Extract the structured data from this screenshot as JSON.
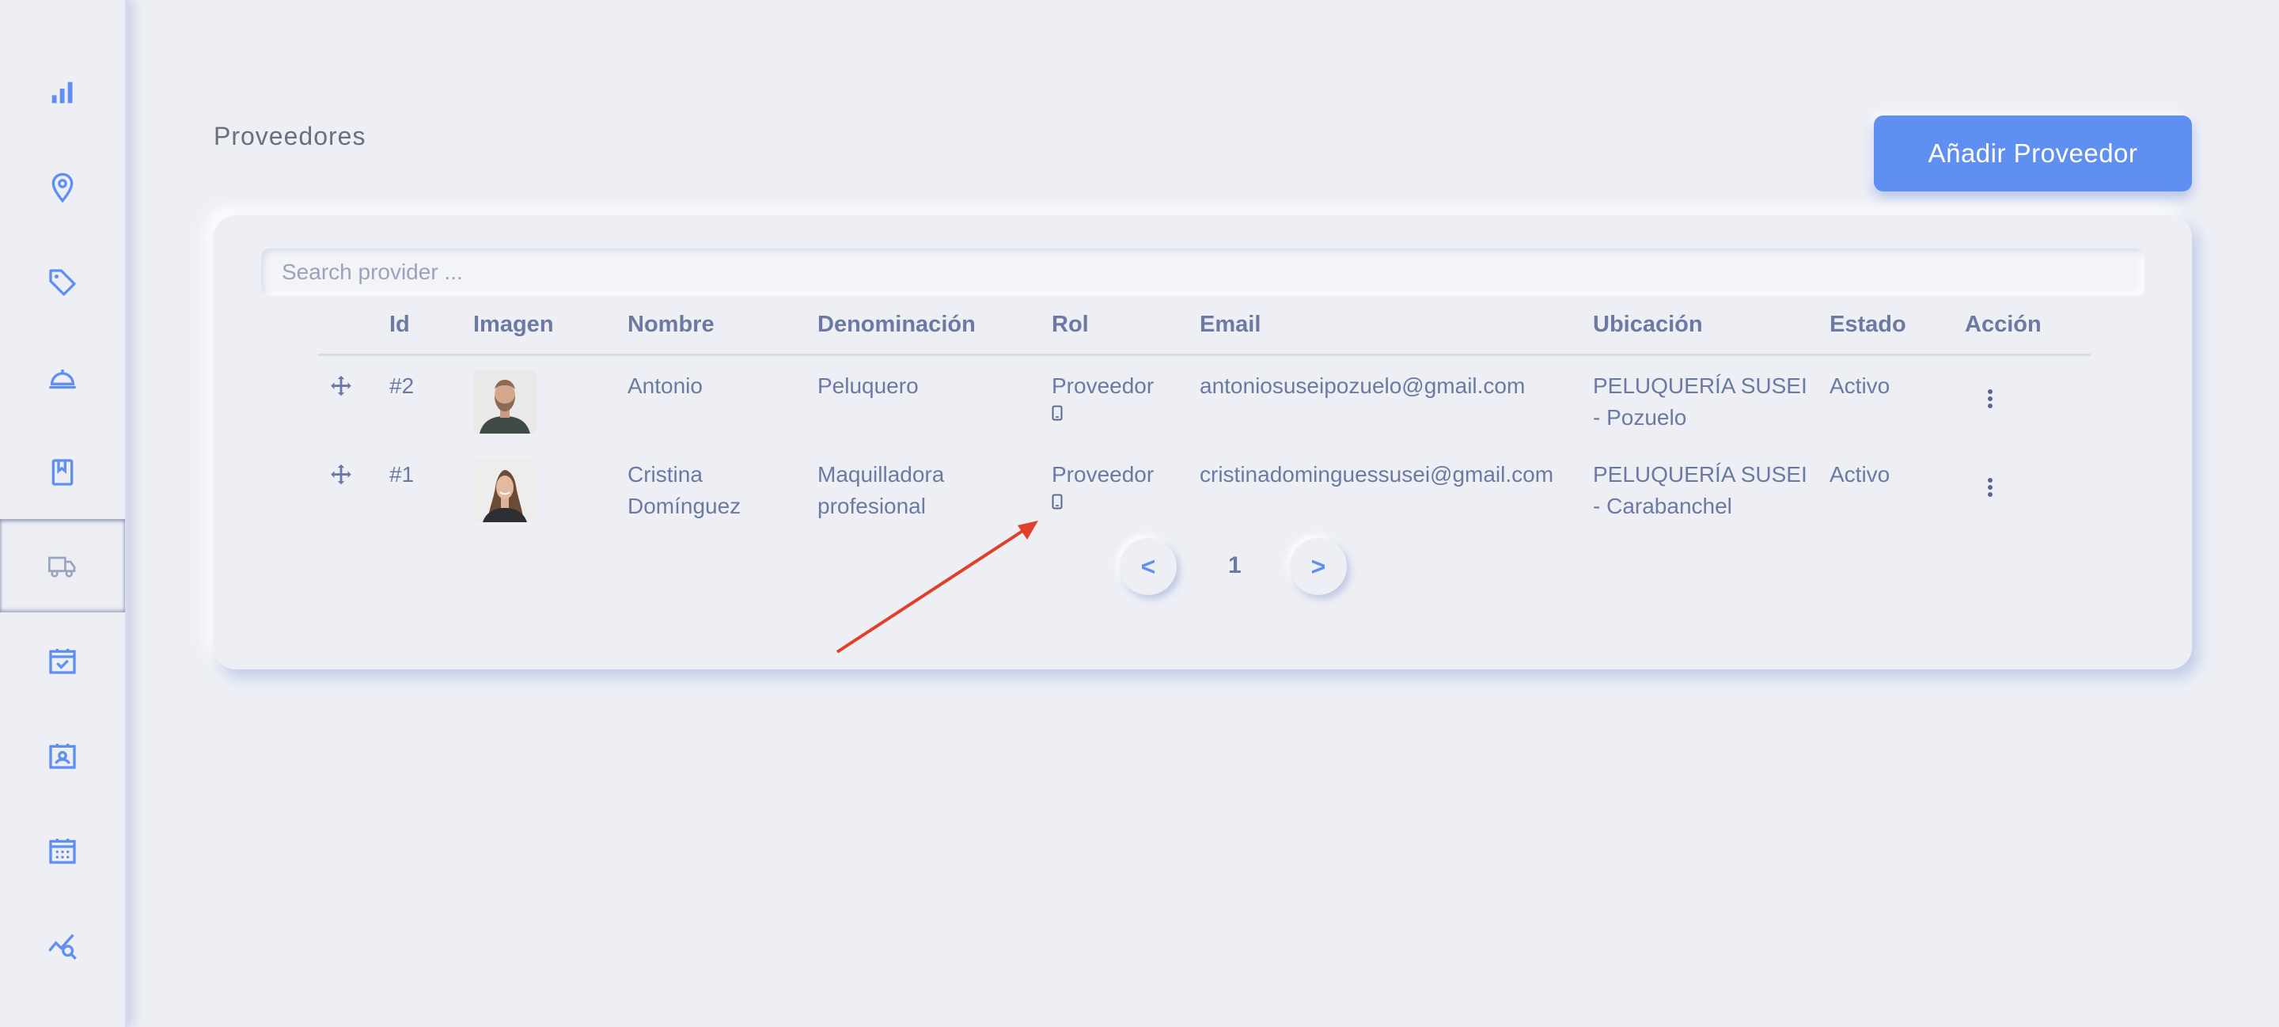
{
  "sidebar": {
    "items": [
      {
        "icon": "bar-chart-icon"
      },
      {
        "icon": "map-pin-icon"
      },
      {
        "icon": "tag-icon"
      },
      {
        "icon": "service-bell-icon"
      },
      {
        "icon": "bookmark-icon"
      },
      {
        "icon": "truck-icon",
        "active": true
      },
      {
        "icon": "calendar-check-icon"
      },
      {
        "icon": "contact-card-icon"
      },
      {
        "icon": "calendar-grid-icon"
      },
      {
        "icon": "chart-search-icon"
      }
    ]
  },
  "header": {
    "title": "Proveedores",
    "add_button": "Añadir Proveedor"
  },
  "search": {
    "placeholder": "Search provider ...",
    "value": ""
  },
  "table": {
    "columns": [
      "Id",
      "Imagen",
      "Nombre",
      "Denominación",
      "Rol",
      "Email",
      "Ubicación",
      "Estado",
      "Acción"
    ],
    "rows": [
      {
        "id": "#2",
        "nombre": [
          "Antonio",
          ""
        ],
        "denominacion": [
          "Peluquero",
          ""
        ],
        "rol": "Proveedor",
        "email": "antoniosuseipozuelo@gmail.com",
        "ubicacion": [
          "PELUQUERÍA SUSEI",
          "- Pozuelo"
        ],
        "estado": "Activo"
      },
      {
        "id": "#1",
        "nombre": [
          "Cristina",
          "Domínguez"
        ],
        "denominacion": [
          "Maquilladora",
          "profesional"
        ],
        "rol": "Proveedor",
        "email": "cristinadominguessusei@gmail.com",
        "ubicacion": [
          "PELUQUERÍA SUSEI",
          "- Carabanchel"
        ],
        "estado": "Activo"
      }
    ]
  },
  "pagination": {
    "prev": "<",
    "current": "1",
    "next": ">"
  },
  "colors": {
    "accent": "#5f8ff0",
    "background": "#edeff5",
    "text": "#6c7aa3",
    "annotation_arrow": "#e0402a"
  }
}
